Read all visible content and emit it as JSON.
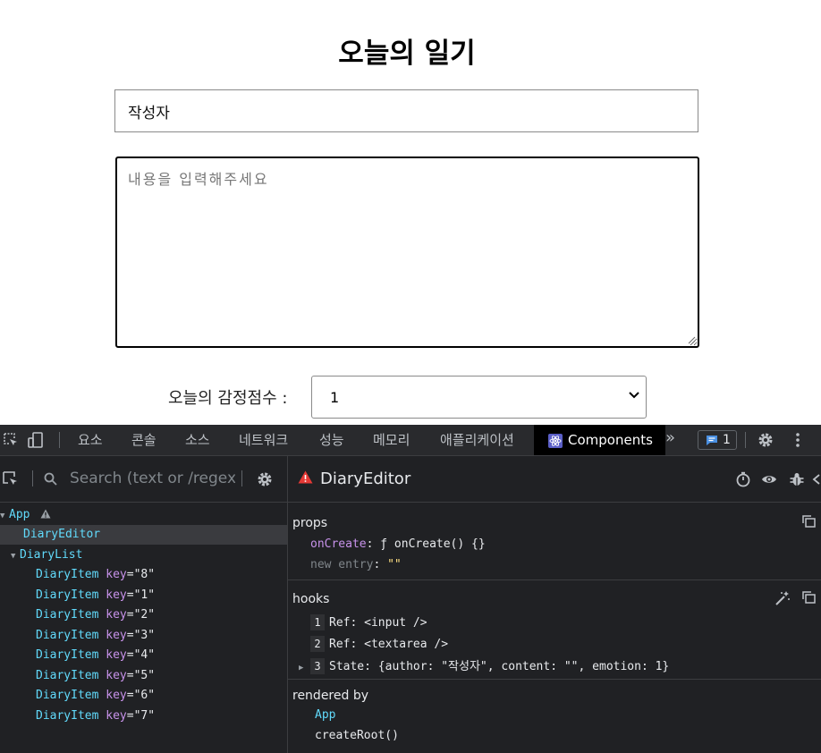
{
  "app": {
    "title": "오늘의 일기",
    "author_value": "작성자",
    "content_placeholder": "내용을 입력해주세요",
    "emotion_label": "오늘의 감정점수 :",
    "emotion_value": "1"
  },
  "devtools": {
    "tabs": [
      "요소",
      "콘솔",
      "소스",
      "네트워크",
      "성능",
      "메모리",
      "애플리케이션"
    ],
    "active_tab": "Components",
    "more_tabs": "»",
    "issues_count": "1",
    "search_placeholder": "Search (text or /regex/)",
    "tree": [
      {
        "name": "App",
        "warn": true
      },
      {
        "name": "DiaryEditor"
      },
      {
        "name": "DiaryList"
      },
      {
        "name": "DiaryItem",
        "key_label": "key",
        "key_value": "\"8\""
      },
      {
        "name": "DiaryItem",
        "key_label": "key",
        "key_value": "\"1\""
      },
      {
        "name": "DiaryItem",
        "key_label": "key",
        "key_value": "\"2\""
      },
      {
        "name": "DiaryItem",
        "key_label": "key",
        "key_value": "\"3\""
      },
      {
        "name": "DiaryItem",
        "key_label": "key",
        "key_value": "\"4\""
      },
      {
        "name": "DiaryItem",
        "key_label": "key",
        "key_value": "\"5\""
      },
      {
        "name": "DiaryItem",
        "key_label": "key",
        "key_value": "\"6\""
      },
      {
        "name": "DiaryItem",
        "key_label": "key",
        "key_value": "\"7\""
      }
    ],
    "inspector": {
      "component": "DiaryEditor",
      "props_title": "props",
      "props": [
        {
          "key": "onCreate",
          "value": "ƒ onCreate() {}"
        },
        {
          "key": "new entry",
          "value": "\"\""
        }
      ],
      "hooks_title": "hooks",
      "hooks": [
        {
          "idx": "1",
          "text": "Ref: <input />"
        },
        {
          "idx": "2",
          "text": "Ref: <textarea />"
        },
        {
          "idx": "3",
          "text": "State: {author: \"작성자\", content: \"\", emotion: 1}"
        }
      ],
      "rendered_by_title": "rendered by",
      "rendered_by": [
        "App",
        "createRoot()"
      ]
    },
    "colors": {
      "component": "#61dafb",
      "prop_key": "#c792ea",
      "string": "#ffe082",
      "warning": "#e53935"
    }
  }
}
